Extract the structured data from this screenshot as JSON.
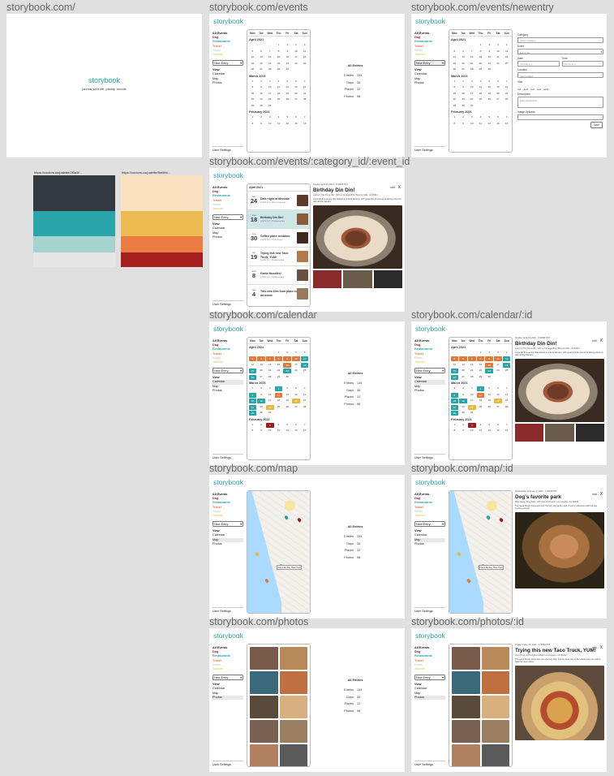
{
  "brand": "storybook",
  "home": {
    "label": "storybook.com/",
    "tagline": "journal your life, plainly, moods"
  },
  "palettes": {
    "left_url": "https://coolors.co/palette/2f3a3f...",
    "right_url": "https://coolors.co/palette/fbe0bb...",
    "left_colors": [
      "#333a3f",
      "#2aa3a9",
      "#a5d3cf",
      "#e6e6e6"
    ],
    "right_colors": [
      "#fbe2c0",
      "#ecbc52",
      "#ec7c44",
      "#a51f1c"
    ]
  },
  "colors": {
    "accent": "#2aa3a9",
    "dog": "#a01c1c",
    "restaurants": "#2aa3a9",
    "travel": "#e07a3b",
    "notes": "#b0cccc",
    "journal": "#e6b93e"
  },
  "sidebar": {
    "all_events": "All Events",
    "categories": [
      "Dog",
      "Restaurants",
      "Travel",
      "Notes",
      "Journal"
    ],
    "new_entry": "New Entry",
    "view": "View",
    "views": [
      "Calendar",
      "Map",
      "Photos"
    ],
    "user_settings": "User Settings"
  },
  "calendar": {
    "weekdays": [
      "Mon",
      "Tue",
      "Wed",
      "Thu",
      "Fri",
      "Sat",
      "Sun"
    ],
    "months": [
      {
        "name": "April 2021",
        "days": [
          "",
          "",
          "",
          "1",
          "2",
          "3",
          "4",
          "5",
          "6",
          "7",
          "8",
          "9",
          "10",
          "11",
          "12",
          "13",
          "14",
          "15",
          "16",
          "17",
          "18",
          "19",
          "20",
          "21",
          "22",
          "23",
          "24",
          "25",
          "26",
          "27",
          "28",
          "29",
          "30",
          ""
        ]
      },
      {
        "name": "March 2021",
        "days": [
          "1",
          "2",
          "3",
          "4",
          "5",
          "6",
          "7",
          "8",
          "9",
          "10",
          "11",
          "12",
          "13",
          "14",
          "15",
          "16",
          "17",
          "18",
          "19",
          "20",
          "21",
          "22",
          "23",
          "24",
          "25",
          "26",
          "27",
          "28",
          "29",
          "30",
          "31"
        ]
      },
      {
        "name": "February 2021",
        "days": [
          "1",
          "2",
          "3",
          "4",
          "5",
          "6",
          "7",
          "8",
          "9",
          "10",
          "11",
          "12",
          "13",
          "14"
        ]
      }
    ]
  },
  "stats": {
    "title": "All Entries",
    "rows": [
      {
        "label": "Entries",
        "value": "134"
      },
      {
        "label": "Days",
        "value": "35"
      },
      {
        "label": "Places",
        "value": "12"
      },
      {
        "label": "Photos",
        "value": "98"
      }
    ]
  },
  "screens": {
    "events": "storybook.com/events",
    "newentry": "storybook.com/events/newentry",
    "event_detail": "storybook.com/events/:category_id/:event_id",
    "calendar": "storybook.com/calendar",
    "calendar_id": "storybook.com/calendar/:id",
    "map": "storybook.com/map",
    "map_id": "storybook.com/map/:id",
    "photos": "storybook.com/photos",
    "photos_id": "storybook.com/photos/:id"
  },
  "newentry_form": {
    "category": "Category",
    "category_ph": "Select Category",
    "event": "Event",
    "event_ph": "Event title",
    "date": "Date",
    "date_ph": "mm/dd/yyyy",
    "time": "Time",
    "time_ph": "hh:mm a.m.",
    "location": "Location",
    "location_ph": "Start location",
    "vibe": "Vibe",
    "vibes": [
      "sad",
      "good",
      "meh",
      "best",
      "awful"
    ],
    "description": "Description",
    "description_ph": "Enter description",
    "uploads": "Image Uploads",
    "save": "Save"
  },
  "event_list": {
    "month": "April 2021",
    "items": [
      {
        "wd": "SAT",
        "dn": "24",
        "title": "Date night at Mezcala",
        "sub": "6:00PM PST | 123 Dr Los Angeles"
      },
      {
        "wd": "SUN",
        "dn": "18",
        "title": "Birthday Din Din!",
        "sub": "6:00PM PST | 1234 Avenue Blvd"
      },
      {
        "wd": "TUE",
        "dn": "30",
        "title": "Coffee place nextdoor",
        "sub": "9:30PM PST | 123 Golf Street"
      },
      {
        "wd": "FRI",
        "dn": "19",
        "title": "Trying this new Taco Truck, YUM!",
        "sub": "2:00PM PST | 123 Avenue Blvd"
      },
      {
        "wd": "MON",
        "dn": "8",
        "title": "Garlic Noodles!",
        "sub": "8:00PM PST | 123 Avenue Blvd"
      },
      {
        "wd": "THU",
        "dn": "4",
        "title": "This new Dim Sum place is da bomb",
        "sub": ""
      }
    ]
  },
  "details": {
    "birthday": {
      "meta": "Sunday, April 18, 2021 - 6:00PM PST",
      "title": "Birthday Din Din!",
      "loc": "Lawry's The Prime Rib, 100 La Cienega Blvd, Beverly Hills, CA 90211",
      "desc": "A wonderful evening that started at a local favorite, with great friends and an amazing prime rib with all the classics.",
      "edit": "edit",
      "close": "X"
    },
    "park": {
      "meta": "Wednesday, February 3, 2021 - 1:00PM PST",
      "title": "Dog's favorite park",
      "loc": "Bark Happy Dog Park, 123 Vista del Puerto, Los Angeles, CA 90294",
      "desc": "The quick brown fox jumps over the lazy dog at the park. A sunny afternoon with the pup running around.",
      "edit": "edit",
      "close": "X"
    },
    "taco": {
      "meta": "Friday, Friday 19, 2021 - 2:00PM PST",
      "title": "Trying this new Taco Truck, YUM!",
      "loc": "Taco Truck, 1470 Anthem Blvd, Los Angeles, CA 90042",
      "desc": "The quick brown fox jumps over the lazy dog. It is the best taco in the whole area, we will be back for more tacos.",
      "edit": "edit",
      "close": "X"
    }
  },
  "map_label": "Plaza del Rey Bark Park"
}
